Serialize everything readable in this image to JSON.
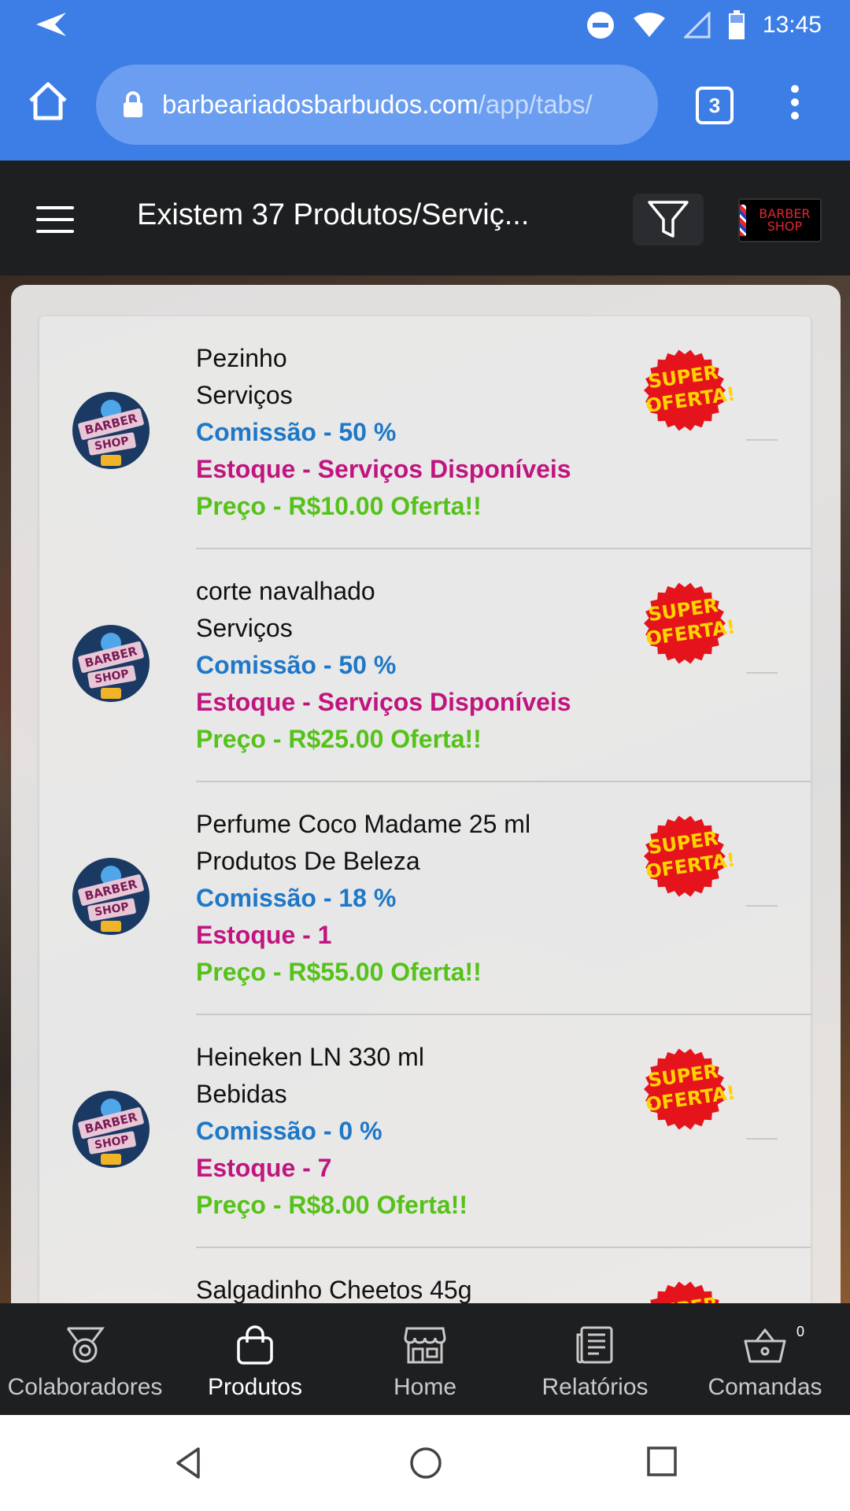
{
  "status_bar": {
    "time": "13:45"
  },
  "browser": {
    "url_domain": "barbeariadosbarbudos.com",
    "url_path": "/app/tabs/",
    "tab_count": "3"
  },
  "header": {
    "title": "Existem 37 Produtos/Serviç...",
    "logo_text": "BARBER SHOP"
  },
  "products": [
    {
      "name": "Pezinho",
      "category": "Serviços",
      "commission": "Comissão - 50 %",
      "stock": "Estoque - Serviços Disponíveis",
      "price": "Preço - R$10.00 Oferta!!",
      "badge": "SUPER OFERTA!"
    },
    {
      "name": "corte navalhado",
      "category": "Serviços",
      "commission": "Comissão - 50 %",
      "stock": "Estoque - Serviços Disponíveis",
      "price": "Preço - R$25.00 Oferta!!",
      "badge": "SUPER OFERTA!"
    },
    {
      "name": "Perfume Coco Madame 25 ml",
      "category": "Produtos De Beleza",
      "commission": "Comissão - 18 %",
      "stock": "Estoque - 1",
      "price": "Preço - R$55.00 Oferta!!",
      "badge": "SUPER OFERTA!"
    },
    {
      "name": "Heineken LN 330 ml",
      "category": "Bebidas",
      "commission": "Comissão - 0 %",
      "stock": "Estoque - 7",
      "price": "Preço - R$8.00 Oferta!!",
      "badge": "SUPER OFERTA!"
    },
    {
      "name": "Salgadinho Cheetos 45g",
      "category": "",
      "commission": "",
      "stock": "",
      "price": "",
      "badge": "SUPER OFERTA!"
    }
  ],
  "avatar_text": {
    "line1": "BARBER",
    "line2": "SHOP"
  },
  "tabs": [
    {
      "label": "Colaboradores",
      "icon": "medal-icon"
    },
    {
      "label": "Produtos",
      "icon": "bag-icon"
    },
    {
      "label": "Home",
      "icon": "store-icon"
    },
    {
      "label": "Relatórios",
      "icon": "report-icon"
    },
    {
      "label": "Comandas",
      "icon": "basket-icon",
      "badge_count": "0"
    }
  ],
  "colors": {
    "browser_blue": "#3d7ee6",
    "app_dark": "#1e1f21",
    "commission_blue": "#1e78c8",
    "stock_magenta": "#c0157f",
    "price_green": "#55c21a",
    "badge_red": "#e5141c",
    "badge_yellow": "#ffd400"
  }
}
